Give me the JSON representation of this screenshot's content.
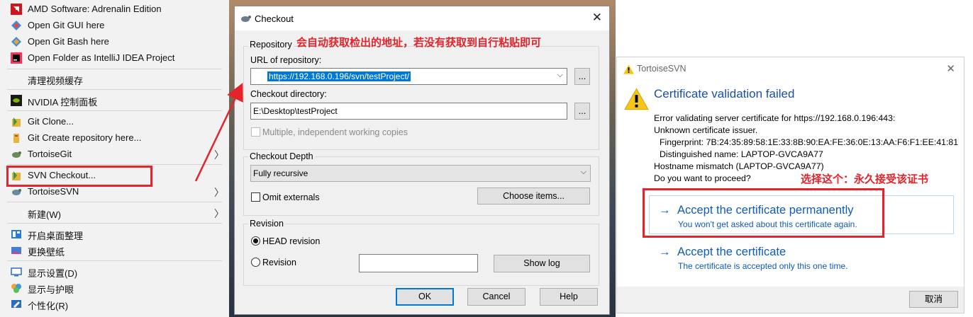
{
  "context_menu": {
    "items": [
      {
        "label": "AMD Software: Adrenalin Edition",
        "icon": "amd-icon"
      },
      {
        "label": "Open Git GUI here",
        "icon": "git-gui-icon"
      },
      {
        "label": "Open Git Bash here",
        "icon": "git-bash-icon"
      },
      {
        "label": "Open Folder as IntelliJ IDEA Project",
        "icon": "intellij-icon"
      },
      {
        "label": "清理视频缓存",
        "icon": ""
      },
      {
        "label": "NVIDIA 控制面板",
        "icon": "nvidia-icon"
      },
      {
        "label": "Git Clone...",
        "icon": "git-clone-icon"
      },
      {
        "label": "Git Create repository here...",
        "icon": "git-create-icon"
      },
      {
        "label": "TortoiseGit",
        "icon": "tortoisegit-icon",
        "submenu": true
      },
      {
        "label": "SVN Checkout...",
        "icon": "svn-checkout-icon"
      },
      {
        "label": "TortoiseSVN",
        "icon": "tortoisesvn-icon",
        "submenu": true
      },
      {
        "label": "新建(W)",
        "icon": "",
        "submenu": true
      },
      {
        "label": "开启桌面整理",
        "icon": "desktop-organize-icon"
      },
      {
        "label": "更换壁纸",
        "icon": "wallpaper-icon"
      },
      {
        "label": "显示设置(D)",
        "icon": "display-settings-icon"
      },
      {
        "label": "显示与护眼",
        "icon": "eye-care-icon"
      },
      {
        "label": "个性化(R)",
        "icon": "personalize-icon"
      }
    ],
    "submenu_glyph": "〉"
  },
  "checkout": {
    "title": "Checkout",
    "close": "✕",
    "repository_group": "Repository",
    "annotation": "会自动获取检出的地址，若没有获取到自行粘贴即可",
    "url_label": "URL of repository:",
    "url_value": "https://192.168.0.196/svn/testProject/",
    "browse": "...",
    "dir_label": "Checkout directory:",
    "dir_value": "E:\\Desktop\\testProject",
    "multiple_label": "Multiple, independent working copies",
    "depth_group": "Checkout Depth",
    "depth_value": "Fully recursive",
    "omit_externals": "Omit externals",
    "choose_items": "Choose items...",
    "revision_group": "Revision",
    "head_revision": "HEAD revision",
    "revision": "Revision",
    "show_log": "Show log",
    "ok": "OK",
    "cancel": "Cancel",
    "help": "Help"
  },
  "cert": {
    "window_title": "TortoiseSVN",
    "close": "✕",
    "heading": "Certificate validation failed",
    "lines": [
      "Error validating server certificate for https://192.168.0.196:443:",
      "Unknown certificate issuer.",
      "Fingerprint: 7B:24:35:89:58:1E:33:8B:90:EA:FE:36:0E:13:AA:F6:F1:EE:41:81",
      "Distinguished name: LAPTOP-GVCA9A77",
      "Hostname mismatch (LAPTOP-GVCA9A77)",
      "Do you want to proceed?"
    ],
    "annotation": "选择这个：永久接受该证书",
    "option1_title": "Accept the certificate permanently",
    "option1_sub": "You won't get asked about this certificate again.",
    "option2_title": "Accept the certificate",
    "option2_sub": "The certificate is accepted only this one time.",
    "arrow": "→",
    "cancel": "取消"
  },
  "colors": {
    "annotation_red": "#e4232b",
    "link_blue": "#0f5bb5",
    "selection_blue": "#0078d7"
  }
}
